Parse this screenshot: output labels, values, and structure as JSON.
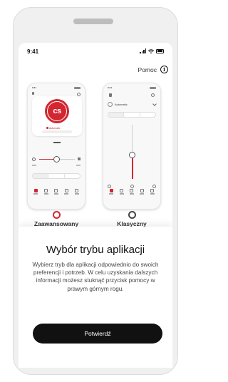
{
  "status_bar": {
    "time": "9:41"
  },
  "header": {
    "help_label": "Pomoc",
    "help_icon": "info-icon"
  },
  "modes": [
    {
      "label": "Zaawansowany",
      "selected": true,
      "preview_logo_text": "cs",
      "preview_label": "Automatic"
    },
    {
      "label": "Klasyczny",
      "selected": false,
      "preview_label": "Automatic"
    }
  ],
  "sheet": {
    "title": "Wybór trybu aplikacji",
    "body": "Wybierz tryb dla aplikacji odpowiednio do swoich preferencji i potrzeb. W celu uzyskania dalszych informacji możesz stuknąć przycisk pomocy w prawym górnym rogu.",
    "confirm_label": "Potwierdź"
  },
  "colors": {
    "accent": "#d22630",
    "button": "#111111",
    "device": "#f0f0f0"
  }
}
